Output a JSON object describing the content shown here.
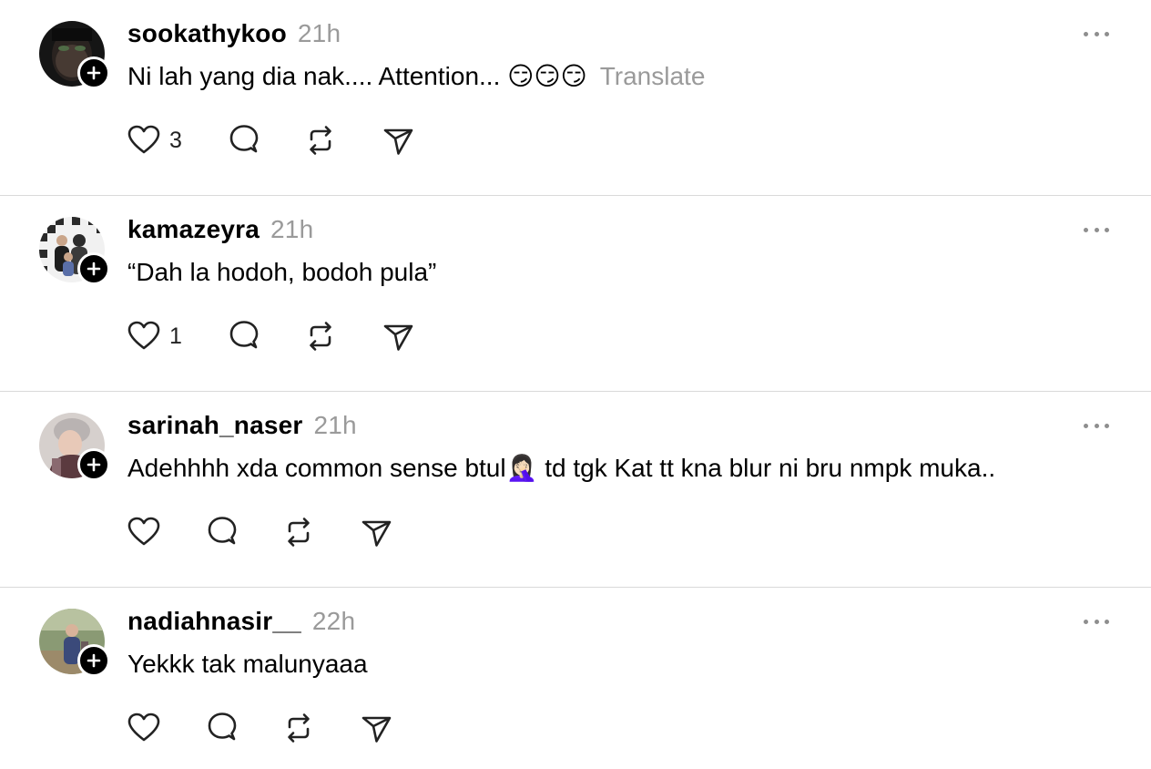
{
  "posts": [
    {
      "username": "sookathykoo",
      "time": "21h",
      "text": "Ni lah yang dia nak.... Attention... 😏😏😏",
      "translate_label": "Translate",
      "like_count": "3",
      "avatar_icon": "masked-face-avatar",
      "colors": {
        "bg": "#1b1b1b",
        "accent": "#3a2b22"
      }
    },
    {
      "username": "kamazeyra",
      "time": "21h",
      "text": "“Dah la hodoh, bodoh pula”",
      "translate_label": "",
      "like_count": "1",
      "avatar_icon": "family-photo-avatar",
      "colors": {
        "bg": "#e8e8e8",
        "accent": "#2b2b2b"
      }
    },
    {
      "username": "sarinah_naser",
      "time": "21h",
      "text": "Adehhhh xda common sense btul🤦🏻‍♀️ td tgk Kat tt kna blur ni bru nmpk muka..",
      "translate_label": "",
      "like_count": "",
      "avatar_icon": "selfie-avatar",
      "colors": {
        "bg": "#cfc7c4",
        "accent": "#6a5050"
      }
    },
    {
      "username": "nadiahnasir__",
      "time": "22h",
      "text": "Yekkk tak malunyaaa",
      "translate_label": "",
      "like_count": "",
      "avatar_icon": "outdoor-photo-avatar",
      "colors": {
        "bg": "#7d8a6a",
        "accent": "#3b4a7a"
      }
    }
  ]
}
